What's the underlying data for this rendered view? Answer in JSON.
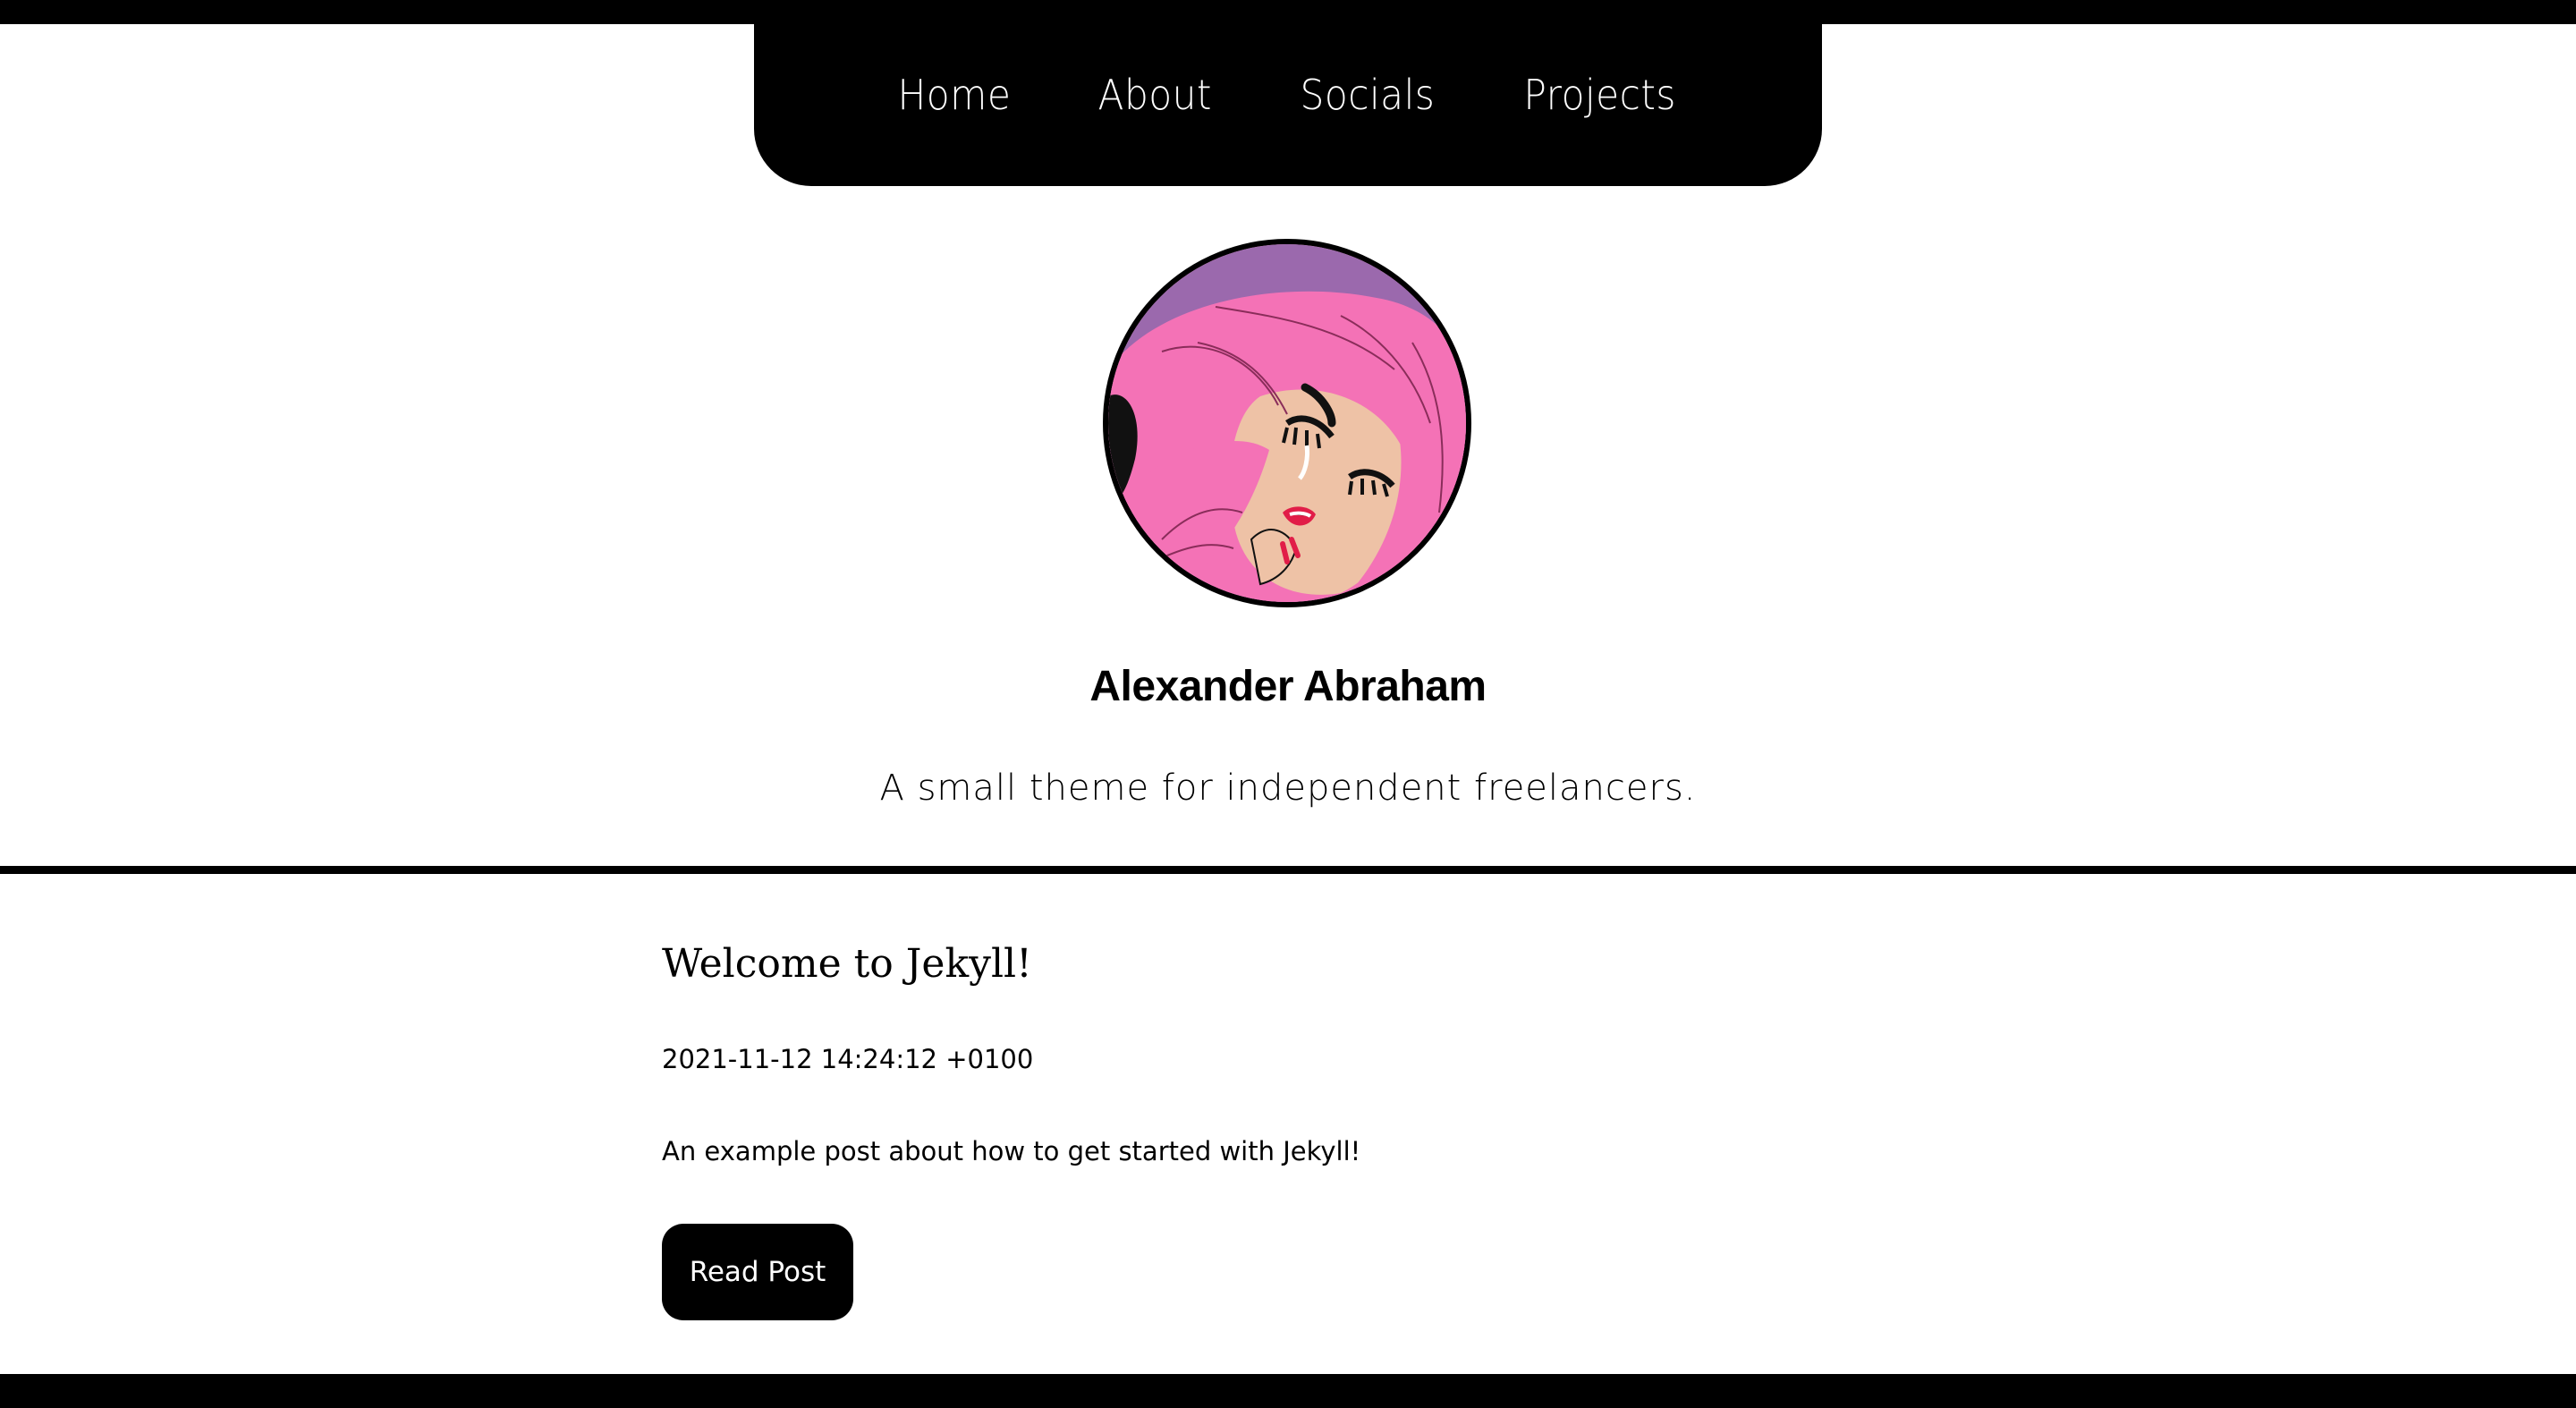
{
  "nav": {
    "items": [
      {
        "label": "Home"
      },
      {
        "label": "About"
      },
      {
        "label": "Socials"
      },
      {
        "label": "Projects"
      }
    ]
  },
  "profile": {
    "avatar_icon": "avatar-illustration",
    "name": "Alexander Abraham",
    "tagline": "A small theme for independent freelancers."
  },
  "post": {
    "title": "Welcome to Jekyll!",
    "date": "2021-11-12 14:24:12 +0100",
    "excerpt": "An example post about how to get started with Jekyll!",
    "button_label": "Read Post"
  },
  "colors": {
    "background": "#ffffff",
    "accent": "#000000",
    "avatar_hair": "#f472b6",
    "avatar_bg": "#9b69ad"
  }
}
